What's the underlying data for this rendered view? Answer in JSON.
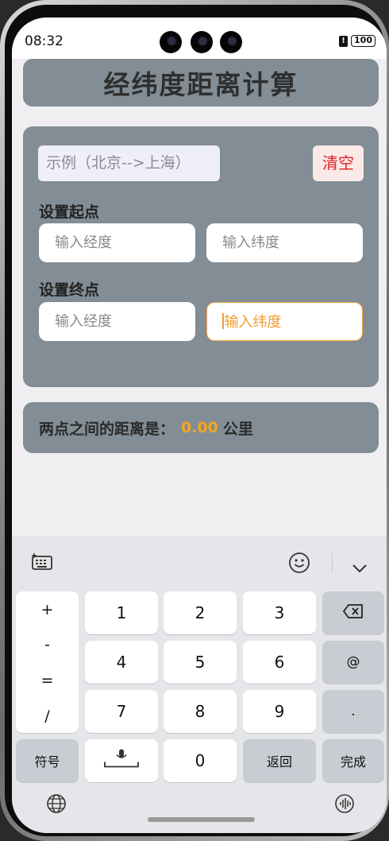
{
  "status_bar": {
    "time": "08:32",
    "battery": "100"
  },
  "app": {
    "title": "经纬度距离计算",
    "example_text": "示例（北京-->上海）",
    "clear_label": "清空",
    "start": {
      "label": "设置起点",
      "longitude_placeholder": "输入经度",
      "latitude_placeholder": "输入纬度"
    },
    "end": {
      "label": "设置终点",
      "longitude_placeholder": "输入经度",
      "latitude_placeholder": "输入纬度"
    },
    "result": {
      "prefix": "两点之间的距离是：",
      "value": "0.00",
      "unit": "公里"
    }
  },
  "keyboard": {
    "toolbar": {
      "left_icon": "ai-keyboard-icon",
      "emoji_icon": "emoji-icon",
      "collapse_icon": "chevron-down-icon"
    },
    "symbols": [
      "+",
      "-",
      "=",
      "/"
    ],
    "digits": [
      "1",
      "2",
      "3",
      "4",
      "5",
      "6",
      "7",
      "8",
      "9",
      "0"
    ],
    "at_key": "@",
    "dot_key": ".",
    "symbol_key": "符号",
    "return_key": "返回",
    "done_key": "完成",
    "accent_colors": {
      "focus": "#f2a23a",
      "clear": "#e02020",
      "result": "#f5a623"
    }
  }
}
